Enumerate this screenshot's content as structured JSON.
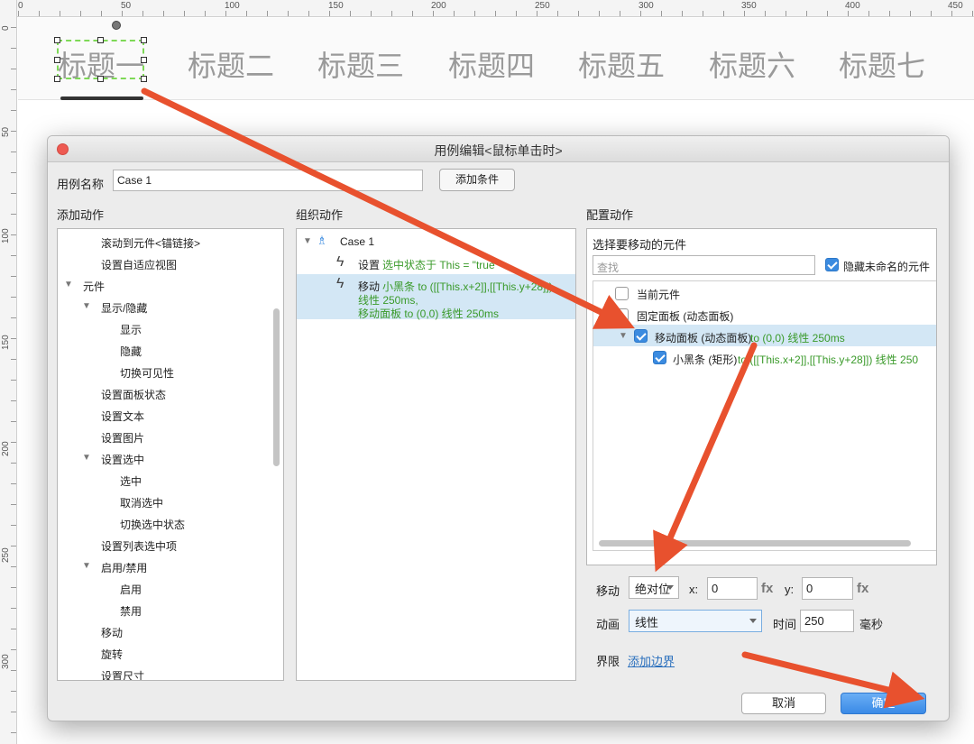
{
  "ruler": {
    "top_labels": [
      "0",
      "50",
      "100",
      "150",
      "200",
      "250",
      "300",
      "350",
      "400",
      "450"
    ],
    "left_labels": [
      "0",
      "50",
      "100",
      "150",
      "200",
      "250",
      "300"
    ]
  },
  "canvas": {
    "tabs": [
      "标题一",
      "标题二",
      "标题三",
      "标题四",
      "标题五",
      "标题六",
      "标题七"
    ]
  },
  "dialog": {
    "title": "用例编辑<鼠标单击时>",
    "case_name_label": "用例名称",
    "case_name_value": "Case 1",
    "add_condition": "添加条件",
    "add_action_header": "添加动作",
    "organize_header": "组织动作",
    "configure_header": "配置动作",
    "actions": [
      "滚动到元件<锚链接>",
      "设置自适应视图",
      "元件",
      "显示/隐藏",
      "显示",
      "隐藏",
      "切换可见性",
      "设置面板状态",
      "设置文本",
      "设置图片",
      "设置选中",
      "选中",
      "取消选中",
      "切换选中状态",
      "设置列表选中项",
      "启用/禁用",
      "启用",
      "禁用",
      "移动",
      "旋转",
      "设置尺寸"
    ],
    "organize": {
      "case_label": "Case 1",
      "set_prefix": "设置",
      "set_detail": "选中状态于 This = \"true\"",
      "move_prefix": "移动",
      "move_line1": "小黑条 to ([[This.x+2]],[[This.y+28]])",
      "move_line2": "线性 250ms,",
      "move_line3": "移动面板 to (0,0) 线性 250ms"
    },
    "configure": {
      "select_label": "选择要移动的元件",
      "search_placeholder": "查找",
      "hide_unnamed": "隐藏未命名的元件",
      "items": [
        {
          "label": "当前元件",
          "detail": ""
        },
        {
          "label": "固定面板 (动态面板)",
          "detail": ""
        },
        {
          "label": "移动面板 (动态面板)",
          "detail": "to (0,0) 线性 250ms"
        },
        {
          "label": "小黑条 (矩形)",
          "detail": "to ([[This.x+2]],[[This.y+28]]) 线性 250"
        }
      ],
      "move_label": "移动",
      "move_mode": "绝对位",
      "x_label": "x:",
      "x_value": "0",
      "y_label": "y:",
      "y_value": "0",
      "fx": "fx",
      "anim_label": "动画",
      "anim_value": "线性",
      "time_label": "时间",
      "time_value": "250",
      "ms_label": "毫秒",
      "bounds_label": "界限",
      "bounds_link": "添加边界"
    },
    "cancel": "取消",
    "ok": "确定"
  },
  "colors": {
    "accent_blue": "#3b8be0",
    "annotation_arrow": "#e8512e",
    "green_text": "#3a9a2a",
    "selection_dash": "#7ed957"
  }
}
